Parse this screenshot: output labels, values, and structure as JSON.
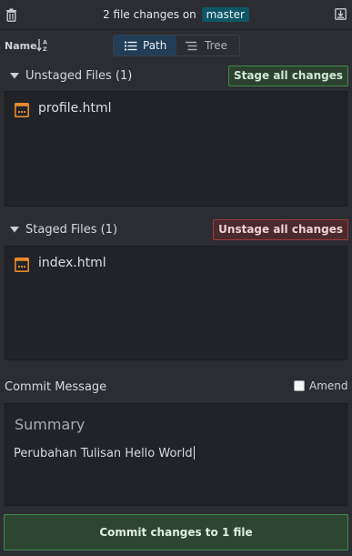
{
  "header": {
    "title_prefix": "2 file changes on",
    "branch": "master"
  },
  "sort": {
    "label": "Name"
  },
  "view_toggle": {
    "path_label": "Path",
    "tree_label": "Tree",
    "selected": "Path"
  },
  "unstaged": {
    "title": "Unstaged Files (1)",
    "action_label": "Stage all changes",
    "files": [
      "profile.html"
    ]
  },
  "staged": {
    "title": "Staged Files (1)",
    "action_label": "Unstage all changes",
    "files": [
      "index.html"
    ]
  },
  "commit": {
    "label": "Commit Message",
    "amend_label": "Amend",
    "summary_placeholder": "Summary",
    "message": "Perubahan Tulisan Hello World",
    "button_label": "Commit changes to 1 file"
  },
  "colors": {
    "background": "#2b2d33",
    "branch_badge": "#0e5566",
    "stage_green": "#3f8a4c",
    "unstage_red": "#a23a3f",
    "file_icon_orange": "#e8892c"
  }
}
